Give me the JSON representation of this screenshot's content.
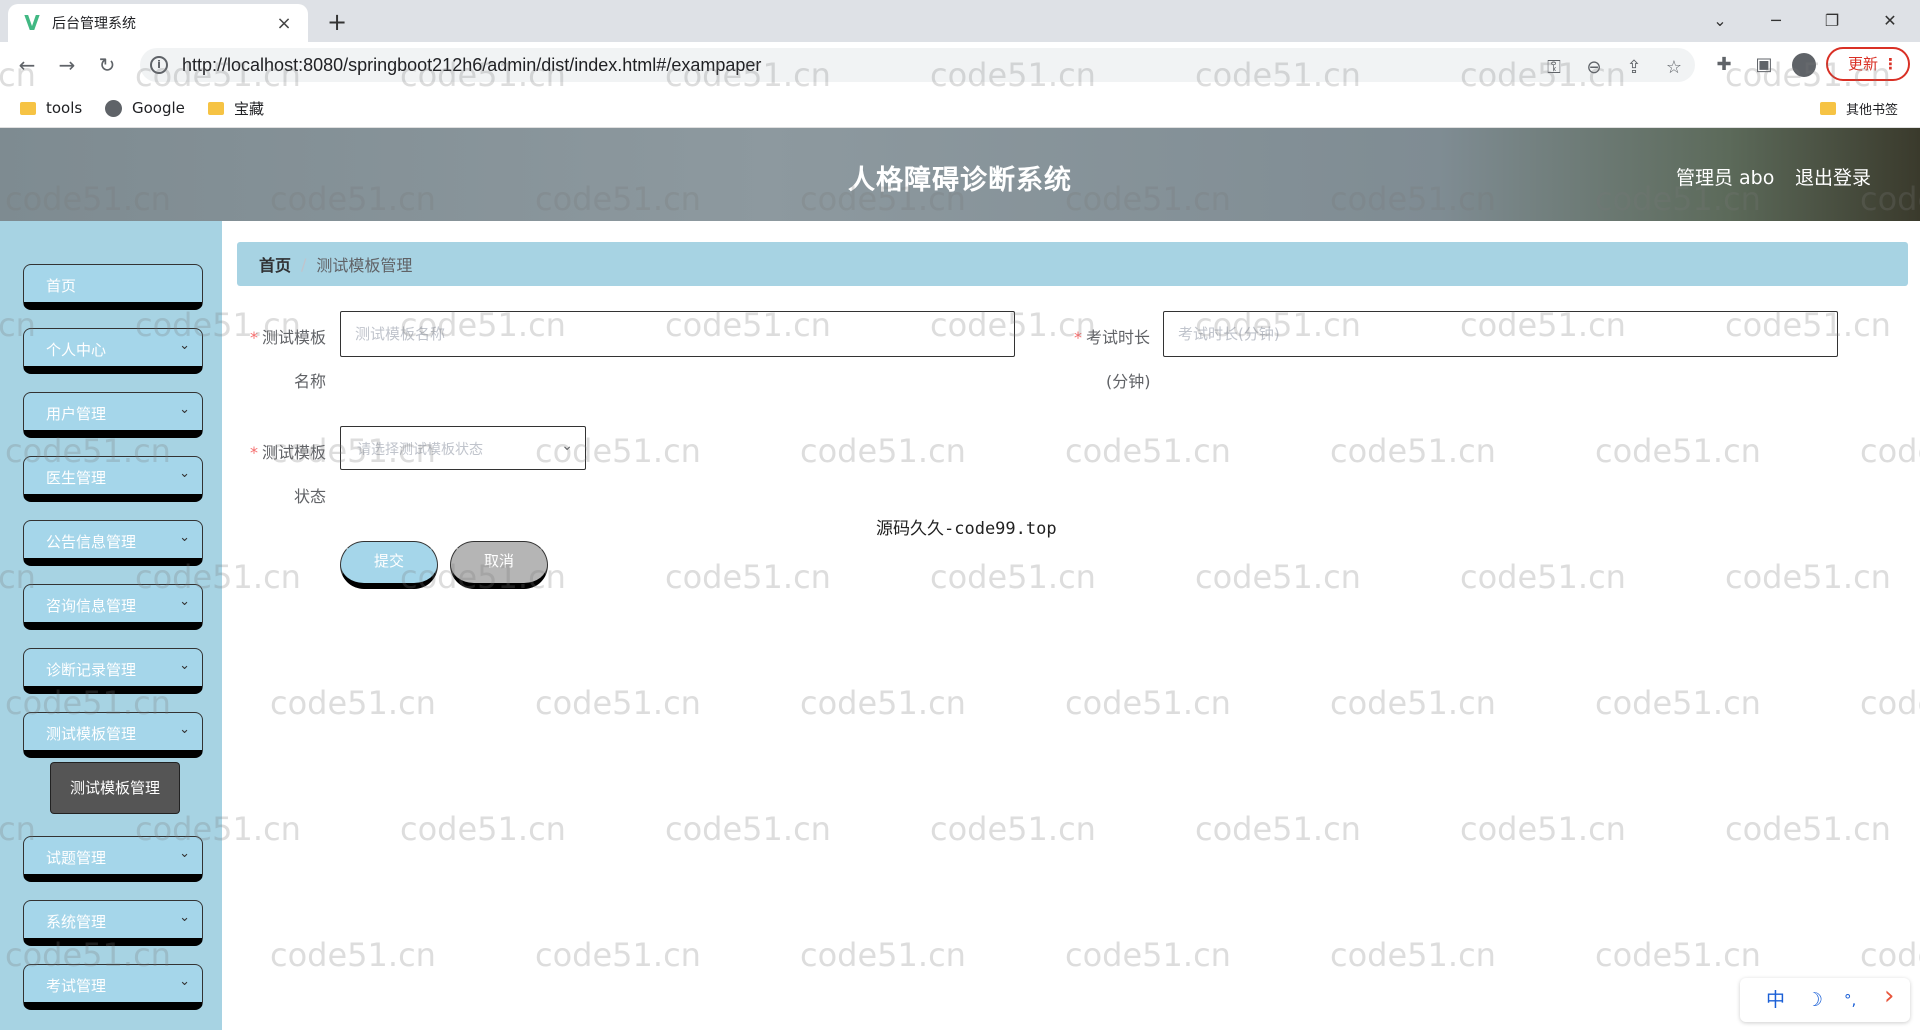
{
  "browser": {
    "tab_title": "后台管理系统",
    "tab_close": "×",
    "new_tab": "+",
    "url": "http://localhost:8080/springboot212h6/admin/dist/index.html#/exampaper",
    "update_label": "更新",
    "bookmarks": [
      "tools",
      "Google",
      "宝藏"
    ],
    "other_bookmarks": "其他书签"
  },
  "header": {
    "title": "人格障碍诊断系统",
    "admin": "管理员 abo",
    "logout": "退出登录"
  },
  "sidebar": {
    "items": [
      {
        "label": "首页",
        "has_children": false
      },
      {
        "label": "个人中心",
        "has_children": true
      },
      {
        "label": "用户管理",
        "has_children": true
      },
      {
        "label": "医生管理",
        "has_children": true
      },
      {
        "label": "公告信息管理",
        "has_children": true
      },
      {
        "label": "咨询信息管理",
        "has_children": true
      },
      {
        "label": "诊断记录管理",
        "has_children": true
      },
      {
        "label": "测试模板管理",
        "has_children": true
      },
      {
        "label": "试题管理",
        "has_children": true
      },
      {
        "label": "系统管理",
        "has_children": true
      },
      {
        "label": "考试管理",
        "has_children": true
      }
    ],
    "submenu_active": "测试模板管理"
  },
  "breadcrumb": {
    "home": "首页",
    "separator": "/",
    "current": "测试模板管理"
  },
  "form": {
    "name_label_1": "测试模板",
    "name_label_2": "名称",
    "name_placeholder": "测试模板名称",
    "duration_label_1": "考试时长",
    "duration_label_2": "(分钟)",
    "duration_placeholder": "考试时长(分钟)",
    "status_label_1": "测试模板",
    "status_label_2": "状态",
    "status_placeholder": "请选择测试模板状态",
    "submit": "提交",
    "cancel": "取消"
  },
  "source_text": "源码久久-code99.top",
  "ime": {
    "lang": "中",
    "moon": "☽",
    "punct": "°,",
    "arrow": "›"
  },
  "watermark": "code51.cn",
  "colors": {
    "sidebar_bg": "#a7d3e3",
    "button_blue": "#a5d6ea",
    "submenu_bg": "#555555",
    "required": "#f56c6c"
  }
}
